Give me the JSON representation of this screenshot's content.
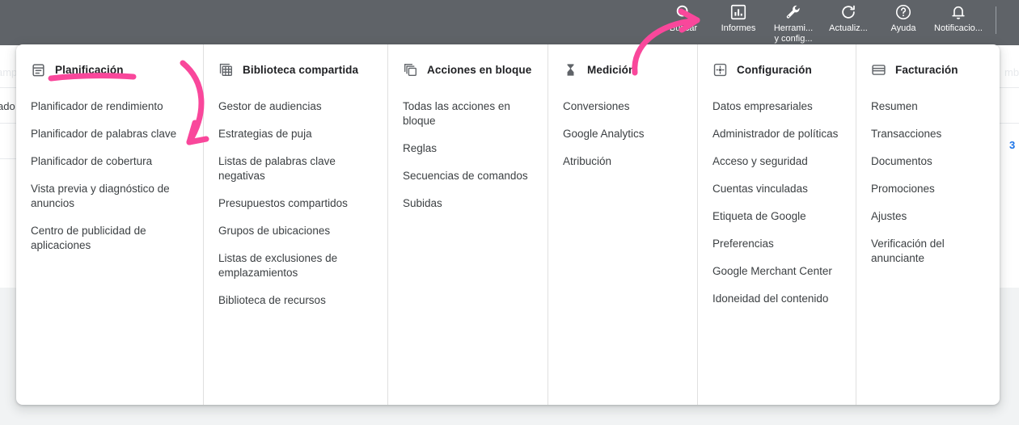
{
  "colors": {
    "toolbar_bg": "#5f6368",
    "panel_bg": "#ffffff",
    "page_bg": "#f1f3f4",
    "annotation_pink": "#f9479b",
    "text_primary": "#202124",
    "text_secondary": "#3c4043",
    "link_blue": "#1a73e8"
  },
  "toolbar": {
    "items": [
      {
        "icon": "search-icon",
        "label": "Buscar"
      },
      {
        "icon": "reports-bar-chart-icon",
        "label": "Informes"
      },
      {
        "icon": "tools-wrench-icon",
        "label": "Herrami...\ny config..."
      },
      {
        "icon": "refresh-icon",
        "label": "Actualiz..."
      },
      {
        "icon": "help-question-icon",
        "label": "Ayuda"
      },
      {
        "icon": "bell-notification-icon",
        "label": "Notificacio..."
      }
    ]
  },
  "background": {
    "left_fragment_top": "amp",
    "left_fragment_row": "ado",
    "right_fragment_top": "mb",
    "right_fragment_blue": "3"
  },
  "menu": {
    "columns": [
      {
        "icon": "planning-calendar-icon",
        "title": "Planificación",
        "items": [
          "Planificador de rendimiento",
          "Planificador de palabras clave",
          "Planificador de cobertura",
          "Vista previa y diagnóstico de anuncios",
          "Centro de publicidad de aplicaciones"
        ]
      },
      {
        "icon": "shared-library-grid-icon",
        "title": "Biblioteca compartida",
        "items": [
          "Gestor de audiencias",
          "Estrategias de puja",
          "Listas de palabras clave negativas",
          "Presupuestos compartidos",
          "Grupos de ubicaciones",
          "Listas de exclusiones de emplazamientos",
          "Biblioteca de recursos"
        ]
      },
      {
        "icon": "bulk-actions-stack-icon",
        "title": "Acciones en bloque",
        "items": [
          "Todas las acciones en bloque",
          "Reglas",
          "Secuencias de comandos",
          "Subidas"
        ]
      },
      {
        "icon": "measurement-hourglass-icon",
        "title": "Medición",
        "items": [
          "Conversiones",
          "Google Analytics",
          "Atribución"
        ]
      },
      {
        "icon": "settings-gear-icon",
        "title": "Configuración",
        "items": [
          "Datos empresariales",
          "Administrador de políticas",
          "Acceso y seguridad",
          "Cuentas vinculadas",
          "Etiqueta de Google",
          "Preferencias",
          "Google Merchant Center",
          "Idoneidad del contenido"
        ]
      },
      {
        "icon": "billing-credit-card-icon",
        "title": "Facturación",
        "items": [
          "Resumen",
          "Transacciones",
          "Documentos",
          "Promociones",
          "Ajustes",
          "Verificación del anunciante"
        ]
      }
    ]
  },
  "annotations": {
    "underline_target": "Planificación",
    "arrow_down_target": "Planificador de palabras clave",
    "arrow_up_target": "Herramientas y configuración"
  }
}
